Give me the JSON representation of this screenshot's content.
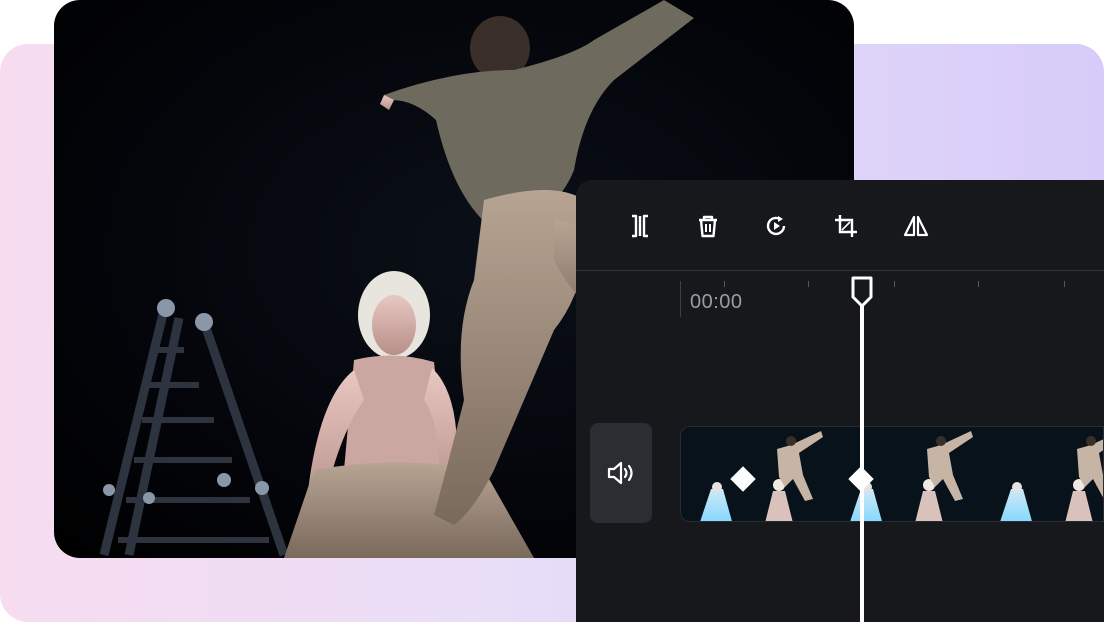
{
  "editor": {
    "toolbar": {
      "tools": [
        {
          "name": "split",
          "icon": "split-icon"
        },
        {
          "name": "delete",
          "icon": "trash-icon"
        },
        {
          "name": "reverse",
          "icon": "replay-icon"
        },
        {
          "name": "crop",
          "icon": "crop-icon"
        },
        {
          "name": "mirror",
          "icon": "flip-icon"
        }
      ]
    },
    "timeline": {
      "timecode": "00:00",
      "audio_icon": "speaker-icon"
    }
  },
  "colors": {
    "editor_bg": "#17181c",
    "accent": "#ffffff",
    "track_highlight": "#7fd6ff"
  }
}
